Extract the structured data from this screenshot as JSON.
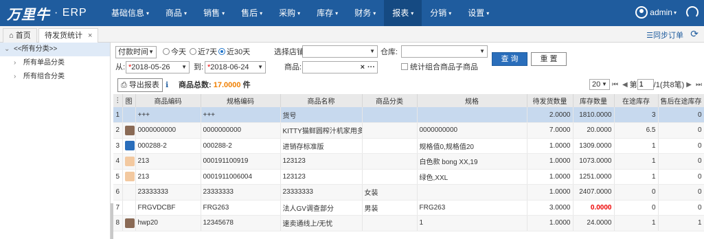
{
  "app": {
    "logo": "万里牛",
    "product": "ERP"
  },
  "nav": [
    "基础信息",
    "商品",
    "销售",
    "售后",
    "采购",
    "库存",
    "财务",
    "报表",
    "分销",
    "设置"
  ],
  "nav_active": "报表",
  "user": {
    "name": "admin"
  },
  "tabs": {
    "home": "首页",
    "current": "待发货统计"
  },
  "toolbar_right": {
    "sync": "同步订单"
  },
  "sidebar": {
    "items": [
      "<<所有分类>>",
      "所有单品分类",
      "所有组合分类"
    ]
  },
  "filter": {
    "time_type": "付款时间",
    "radios": [
      "今天",
      "近7天",
      "近30天"
    ],
    "radio_selected": "近30天",
    "shop_label": "选择店铺:",
    "warehouse_label": "仓库:",
    "from_label": "从:",
    "from_value": "2018-05-26",
    "to_label": "到:",
    "to_value": "2018-06-24",
    "goods_label": "商品:",
    "combo_checkbox": "统计组合商品子商品",
    "query_btn": "查 询",
    "reset_btn": "重 置",
    "export_btn": "导出报表",
    "total_label": "商品总数:",
    "total_value": "17.0000",
    "total_unit": "件"
  },
  "pager": {
    "page_size": "20",
    "page_label": "第",
    "page": "1",
    "total_pages": "/1(共8笔)"
  },
  "table": {
    "headers": [
      "图",
      "商品编码",
      "规格编码",
      "商品名称",
      "商品分类",
      "规格",
      "待发货数量",
      "库存数量",
      "在途库存",
      "售后在途库存"
    ],
    "rows": [
      {
        "no": "1",
        "img": "",
        "code": "+++",
        "spec_code": "+++",
        "name": "货号",
        "cat": "",
        "spec": "",
        "pending": "2.0000",
        "stock": "1810.0000",
        "transit": "3",
        "after": "0"
      },
      {
        "no": "2",
        "img": "photo",
        "code": "0000000000",
        "spec_code": "0000000000",
        "name": "KITTY猫鲜圆榨汁机家用多功",
        "cat": "",
        "spec": "0000000000",
        "pending": "7.0000",
        "stock": "20.0000",
        "transit": "6.5",
        "after": "0"
      },
      {
        "no": "3",
        "img": "logo",
        "code": "000288-2",
        "spec_code": "000288-2",
        "name": "进销存标准版",
        "cat": "",
        "spec": "规格值0,规格值20",
        "pending": "1.0000",
        "stock": "1309.0000",
        "transit": "1",
        "after": "0"
      },
      {
        "no": "4",
        "img": "face",
        "code": "213",
        "spec_code": "000191100919",
        "name": "123123",
        "cat": "",
        "spec": "白色款 bong XX,19",
        "pending": "1.0000",
        "stock": "1073.0000",
        "transit": "1",
        "after": "0"
      },
      {
        "no": "5",
        "img": "face",
        "code": "213",
        "spec_code": "0001911006004",
        "name": "123123",
        "cat": "",
        "spec": "绿色,XXL",
        "pending": "1.0000",
        "stock": "1251.0000",
        "transit": "1",
        "after": "0"
      },
      {
        "no": "6",
        "img": "",
        "code": "23333333",
        "spec_code": "23333333",
        "name": "23333333",
        "cat": "女装",
        "spec": "",
        "pending": "1.0000",
        "stock": "2407.0000",
        "transit": "0",
        "after": "0"
      },
      {
        "no": "7",
        "img": "",
        "code": "FRGVDCBF",
        "spec_code": "FRG263",
        "name": "法人GV调查部分",
        "cat": "男装",
        "spec": "FRG263",
        "pending": "3.0000",
        "stock": "0.0000",
        "transit": "0",
        "after": "0"
      },
      {
        "no": "8",
        "img": "photo",
        "code": "hwp20",
        "spec_code": "12345678",
        "name": "速卖通线上/无忧",
        "cat": "",
        "spec": "1",
        "pending": "1.0000",
        "stock": "24.0000",
        "transit": "1",
        "after": "1"
      }
    ]
  },
  "colors": {
    "topbar": "#1f5c9e",
    "accent": "#2a6ebb",
    "total": "#f07f00",
    "negative": "#e00000",
    "highlight_row": "#c7d9ee"
  }
}
